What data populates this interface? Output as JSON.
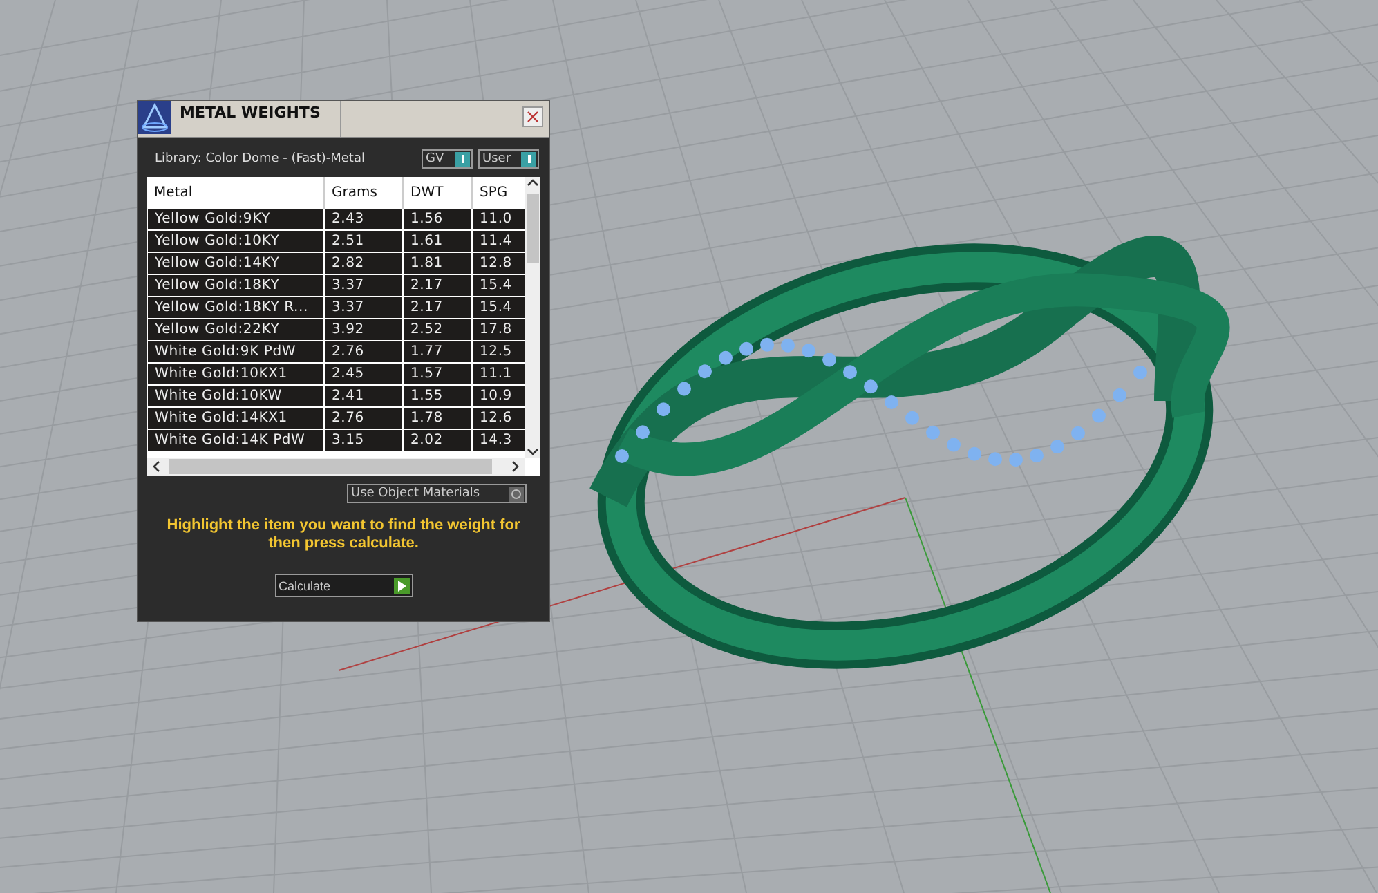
{
  "window": {
    "title": "METAL WEIGHTS"
  },
  "library": {
    "label": "Library: Color Dome - (Fast)-Metal"
  },
  "toggles": [
    {
      "label": "GV",
      "on": true
    },
    {
      "label": "User",
      "on": true
    }
  ],
  "table": {
    "columns": [
      "Metal",
      "Grams",
      "DWT",
      "SPG"
    ],
    "rows": [
      [
        "Yellow Gold:9KY",
        "2.43",
        "1.56",
        "11.0"
      ],
      [
        "Yellow Gold:10KY",
        "2.51",
        "1.61",
        "11.4"
      ],
      [
        "Yellow Gold:14KY",
        "2.82",
        "1.81",
        "12.8"
      ],
      [
        "Yellow Gold:18KY",
        "3.37",
        "2.17",
        "15.4"
      ],
      [
        "Yellow Gold:18KY R...",
        "3.37",
        "2.17",
        "15.4"
      ],
      [
        "Yellow Gold:22KY",
        "3.92",
        "2.52",
        "17.8"
      ],
      [
        "White Gold:9K PdW",
        "2.76",
        "1.77",
        "12.5"
      ],
      [
        "White Gold:10KX1",
        "2.45",
        "1.57",
        "11.1"
      ],
      [
        "White Gold:10KW",
        "2.41",
        "1.55",
        "10.9"
      ],
      [
        "White Gold:14KX1",
        "2.76",
        "1.78",
        "12.6"
      ],
      [
        "White Gold:14K PdW",
        "3.15",
        "2.02",
        "14.3"
      ]
    ]
  },
  "object_materials": {
    "label": "Use Object Materials",
    "on": false
  },
  "instruction": "Highlight the item you want to find the weight for then press calculate.",
  "calculate_button": {
    "label": "Calculate"
  }
}
